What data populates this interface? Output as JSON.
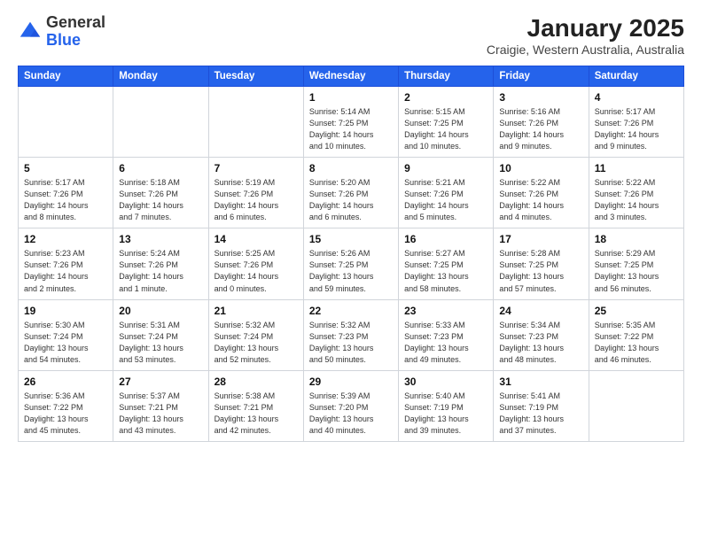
{
  "header": {
    "logo_general": "General",
    "logo_blue": "Blue",
    "title": "January 2025",
    "subtitle": "Craigie, Western Australia, Australia"
  },
  "days_of_week": [
    "Sunday",
    "Monday",
    "Tuesday",
    "Wednesday",
    "Thursday",
    "Friday",
    "Saturday"
  ],
  "weeks": [
    [
      {
        "day": "",
        "info": ""
      },
      {
        "day": "",
        "info": ""
      },
      {
        "day": "",
        "info": ""
      },
      {
        "day": "1",
        "info": "Sunrise: 5:14 AM\nSunset: 7:25 PM\nDaylight: 14 hours\nand 10 minutes."
      },
      {
        "day": "2",
        "info": "Sunrise: 5:15 AM\nSunset: 7:25 PM\nDaylight: 14 hours\nand 10 minutes."
      },
      {
        "day": "3",
        "info": "Sunrise: 5:16 AM\nSunset: 7:26 PM\nDaylight: 14 hours\nand 9 minutes."
      },
      {
        "day": "4",
        "info": "Sunrise: 5:17 AM\nSunset: 7:26 PM\nDaylight: 14 hours\nand 9 minutes."
      }
    ],
    [
      {
        "day": "5",
        "info": "Sunrise: 5:17 AM\nSunset: 7:26 PM\nDaylight: 14 hours\nand 8 minutes."
      },
      {
        "day": "6",
        "info": "Sunrise: 5:18 AM\nSunset: 7:26 PM\nDaylight: 14 hours\nand 7 minutes."
      },
      {
        "day": "7",
        "info": "Sunrise: 5:19 AM\nSunset: 7:26 PM\nDaylight: 14 hours\nand 6 minutes."
      },
      {
        "day": "8",
        "info": "Sunrise: 5:20 AM\nSunset: 7:26 PM\nDaylight: 14 hours\nand 6 minutes."
      },
      {
        "day": "9",
        "info": "Sunrise: 5:21 AM\nSunset: 7:26 PM\nDaylight: 14 hours\nand 5 minutes."
      },
      {
        "day": "10",
        "info": "Sunrise: 5:22 AM\nSunset: 7:26 PM\nDaylight: 14 hours\nand 4 minutes."
      },
      {
        "day": "11",
        "info": "Sunrise: 5:22 AM\nSunset: 7:26 PM\nDaylight: 14 hours\nand 3 minutes."
      }
    ],
    [
      {
        "day": "12",
        "info": "Sunrise: 5:23 AM\nSunset: 7:26 PM\nDaylight: 14 hours\nand 2 minutes."
      },
      {
        "day": "13",
        "info": "Sunrise: 5:24 AM\nSunset: 7:26 PM\nDaylight: 14 hours\nand 1 minute."
      },
      {
        "day": "14",
        "info": "Sunrise: 5:25 AM\nSunset: 7:26 PM\nDaylight: 14 hours\nand 0 minutes."
      },
      {
        "day": "15",
        "info": "Sunrise: 5:26 AM\nSunset: 7:25 PM\nDaylight: 13 hours\nand 59 minutes."
      },
      {
        "day": "16",
        "info": "Sunrise: 5:27 AM\nSunset: 7:25 PM\nDaylight: 13 hours\nand 58 minutes."
      },
      {
        "day": "17",
        "info": "Sunrise: 5:28 AM\nSunset: 7:25 PM\nDaylight: 13 hours\nand 57 minutes."
      },
      {
        "day": "18",
        "info": "Sunrise: 5:29 AM\nSunset: 7:25 PM\nDaylight: 13 hours\nand 56 minutes."
      }
    ],
    [
      {
        "day": "19",
        "info": "Sunrise: 5:30 AM\nSunset: 7:24 PM\nDaylight: 13 hours\nand 54 minutes."
      },
      {
        "day": "20",
        "info": "Sunrise: 5:31 AM\nSunset: 7:24 PM\nDaylight: 13 hours\nand 53 minutes."
      },
      {
        "day": "21",
        "info": "Sunrise: 5:32 AM\nSunset: 7:24 PM\nDaylight: 13 hours\nand 52 minutes."
      },
      {
        "day": "22",
        "info": "Sunrise: 5:32 AM\nSunset: 7:23 PM\nDaylight: 13 hours\nand 50 minutes."
      },
      {
        "day": "23",
        "info": "Sunrise: 5:33 AM\nSunset: 7:23 PM\nDaylight: 13 hours\nand 49 minutes."
      },
      {
        "day": "24",
        "info": "Sunrise: 5:34 AM\nSunset: 7:23 PM\nDaylight: 13 hours\nand 48 minutes."
      },
      {
        "day": "25",
        "info": "Sunrise: 5:35 AM\nSunset: 7:22 PM\nDaylight: 13 hours\nand 46 minutes."
      }
    ],
    [
      {
        "day": "26",
        "info": "Sunrise: 5:36 AM\nSunset: 7:22 PM\nDaylight: 13 hours\nand 45 minutes."
      },
      {
        "day": "27",
        "info": "Sunrise: 5:37 AM\nSunset: 7:21 PM\nDaylight: 13 hours\nand 43 minutes."
      },
      {
        "day": "28",
        "info": "Sunrise: 5:38 AM\nSunset: 7:21 PM\nDaylight: 13 hours\nand 42 minutes."
      },
      {
        "day": "29",
        "info": "Sunrise: 5:39 AM\nSunset: 7:20 PM\nDaylight: 13 hours\nand 40 minutes."
      },
      {
        "day": "30",
        "info": "Sunrise: 5:40 AM\nSunset: 7:19 PM\nDaylight: 13 hours\nand 39 minutes."
      },
      {
        "day": "31",
        "info": "Sunrise: 5:41 AM\nSunset: 7:19 PM\nDaylight: 13 hours\nand 37 minutes."
      },
      {
        "day": "",
        "info": ""
      }
    ]
  ]
}
